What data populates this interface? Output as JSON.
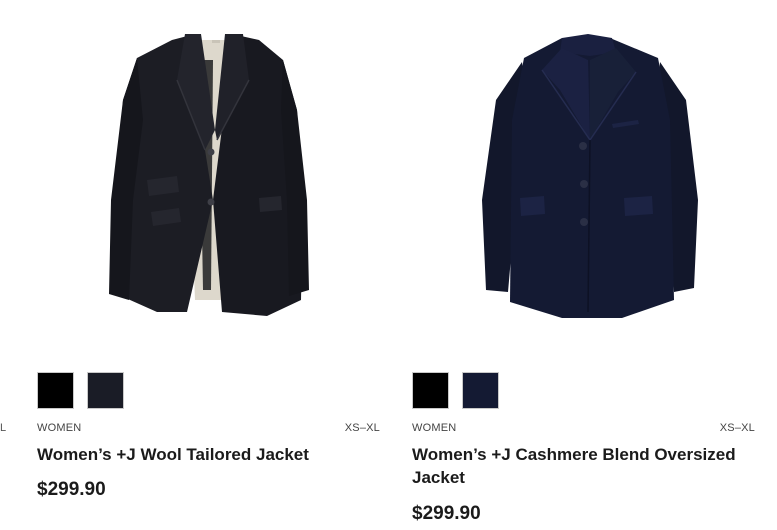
{
  "edge_fragment": "L",
  "products": [
    {
      "category": "WOMEN",
      "sizes": "XS–XL",
      "name": "Women’s +J Wool Tailored Jacket",
      "price": "$299.90",
      "swatches": [
        "#000000",
        "#1a1c26"
      ]
    },
    {
      "category": "WOMEN",
      "sizes": "XS–XL",
      "name": "Women’s +J Cashmere Blend Oversized Jacket",
      "price": "$299.90",
      "swatches": [
        "#000000",
        "#141a33"
      ]
    }
  ],
  "colors": {
    "jacket_black": "#181a22",
    "jacket_navy": "#141a33",
    "text": "#1b1b1b"
  }
}
